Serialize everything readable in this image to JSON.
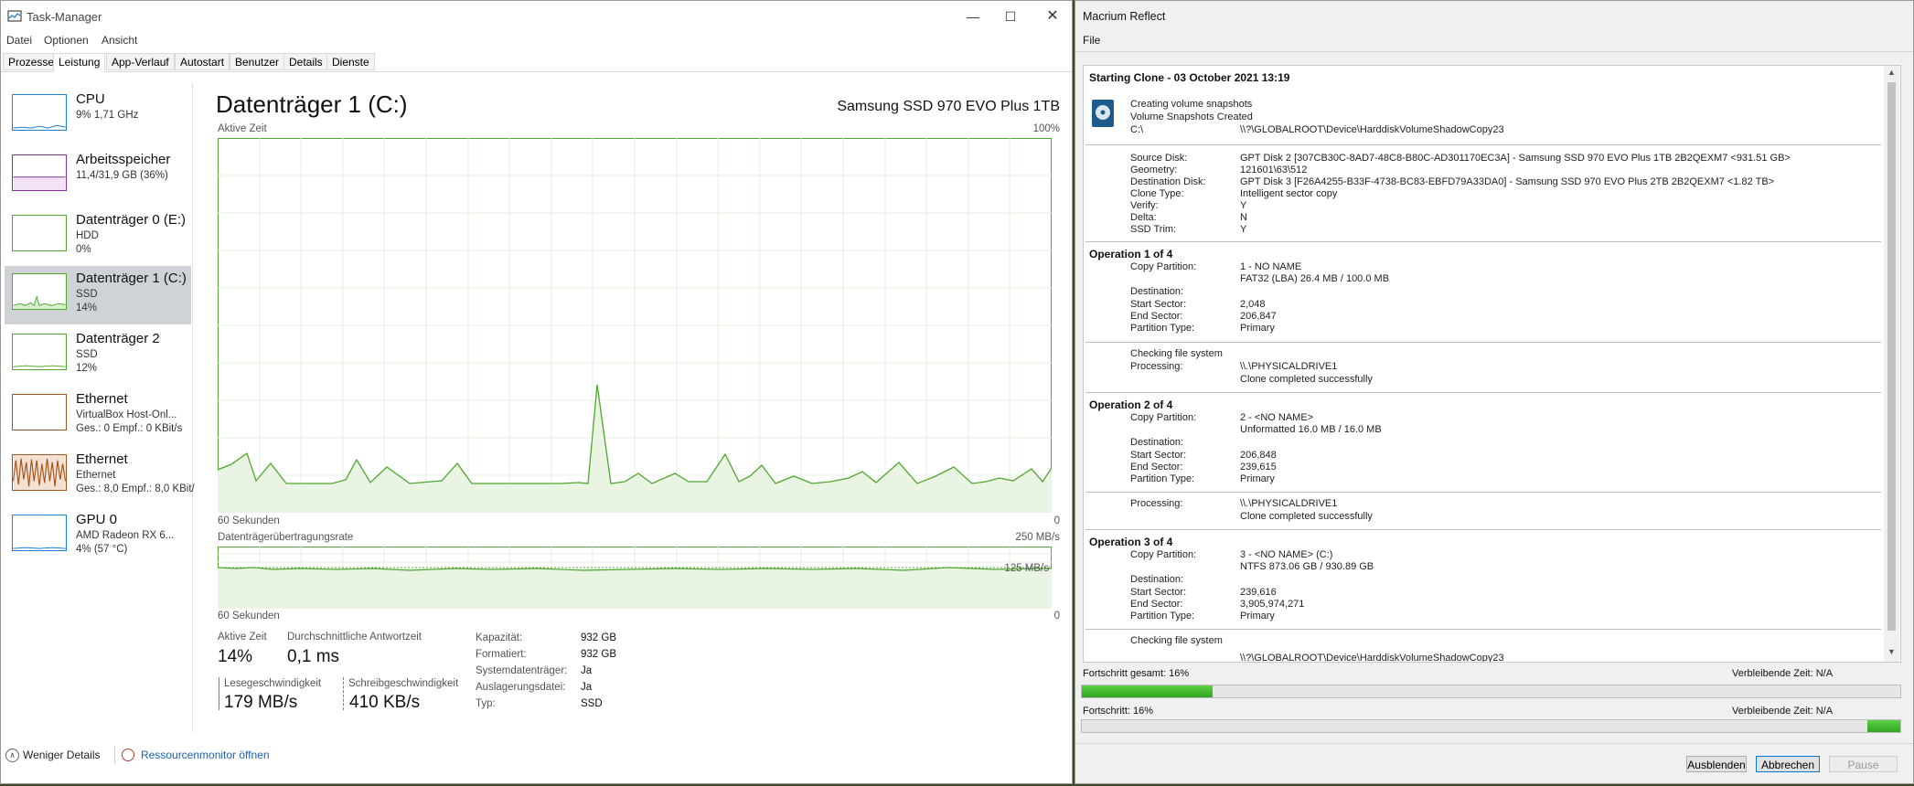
{
  "taskmanager": {
    "title": "Task-Manager",
    "menu": [
      "Datei",
      "Optionen",
      "Ansicht"
    ],
    "tabs": [
      "Prozesse",
      "Leistung",
      "App-Verlauf",
      "Autostart",
      "Benutzer",
      "Details",
      "Dienste"
    ],
    "sidebar": [
      {
        "name": "CPU",
        "sub1": "9% 1,71 GHz",
        "sub2": "",
        "sub3": "",
        "color": "#1d7fd4"
      },
      {
        "name": "Arbeitsspeicher",
        "sub1": "11,4/31,9 GB (36%)",
        "sub2": "",
        "sub3": "",
        "color": "#8b2fa8"
      },
      {
        "name": "Datenträger 0 (E:)",
        "sub1": "HDD",
        "sub2": "0%",
        "sub3": "",
        "color": "#4ea72e"
      },
      {
        "name": "Datenträger 1 (C:)",
        "sub1": "SSD",
        "sub2": "14%",
        "sub3": "",
        "color": "#4ea72e"
      },
      {
        "name": "Datenträger 2",
        "sub1": "SSD",
        "sub2": "12%",
        "sub3": "",
        "color": "#4ea72e"
      },
      {
        "name": "Ethernet",
        "sub1": "VirtualBox Host-Onl...",
        "sub2": "Ges.: 0 Empf.: 0 KBit/s",
        "sub3": "",
        "color": "#a6531b"
      },
      {
        "name": "Ethernet",
        "sub1": "Ethernet",
        "sub2": "Ges.: 8,0 Empf.: 8,0 KBit/",
        "sub3": "",
        "color": "#a6531b"
      },
      {
        "name": "GPU 0",
        "sub1": "AMD Radeon RX 6...",
        "sub2": "4% (57 °C)",
        "sub3": "",
        "color": "#1d7fd4"
      }
    ],
    "main": {
      "title": "Datenträger 1 (C:)",
      "device": "Samsung SSD 970 EVO Plus 1TB",
      "graph1_label": "Aktive Zeit",
      "graph1_max": "100%",
      "graph1_time": "60 Sekunden",
      "graph1_zero": "0",
      "graph2_label": "Datenträgerübertragungsrate",
      "graph2_max": "250 MB/s",
      "graph2_mid": "125 MB/s",
      "graph2_time": "60 Sekunden",
      "graph2_zero": "0",
      "stats": {
        "active_label": "Aktive Zeit",
        "active_value": "14%",
        "response_label": "Durchschnittliche Antwortzeit",
        "response_value": "0,1 ms",
        "read_label": "Lesegeschwindigkeit",
        "read_value": "179 MB/s",
        "write_label": "Schreibgeschwindigkeit",
        "write_value": "410 KB/s"
      },
      "props": [
        {
          "k": "Kapazität:",
          "v": "932 GB"
        },
        {
          "k": "Formatiert:",
          "v": "932 GB"
        },
        {
          "k": "Systemdatenträger:",
          "v": "Ja"
        },
        {
          "k": "Auslagerungsdatei:",
          "v": "Ja"
        },
        {
          "k": "Typ:",
          "v": "SSD"
        }
      ]
    },
    "footer": {
      "less": "Weniger Details",
      "resmon": "Ressourcenmonitor öffnen"
    }
  },
  "macrium": {
    "title": "Macrium Reflect",
    "menu": "File",
    "heading": "Starting Clone - 03 October 2021   13:19",
    "snapshot": [
      "Creating volume snapshots",
      "Volume Snapshots Created",
      "C:\\",
      "\\\\?\\GLOBALROOT\\Device\\HarddiskVolumeShadowCopy23"
    ],
    "info": [
      {
        "k": "Source Disk:",
        "v": "GPT Disk 2 [307CB30C-8AD7-48C8-B80C-AD301170EC3A] - Samsung SSD 970 EVO Plus 1TB 2B2QEXM7  <931.51 GB>"
      },
      {
        "k": "Geometry:",
        "v": "121601\\63\\512"
      },
      {
        "k": "Destination Disk:",
        "v": "GPT Disk 3 [F26A4255-B33F-4738-BC83-EBFD79A33DA0] - Samsung SSD 970 EVO Plus 2TB 2B2QEXM7  <1.82 TB>"
      },
      {
        "k": "Clone Type:",
        "v": "Intelligent sector copy"
      },
      {
        "k": "Verify:",
        "v": "Y"
      },
      {
        "k": "Delta:",
        "v": "N"
      },
      {
        "k": "SSD Trim:",
        "v": "Y"
      }
    ],
    "op1": {
      "head": "Operation 1 of 4",
      "rows": [
        {
          "k": "Copy Partition:",
          "v": "1 - NO NAME"
        },
        {
          "k": "",
          "v": "FAT32 (LBA) 26.4 MB / 100.0 MB"
        },
        {
          "k": "Destination:",
          "v": ""
        },
        {
          "k": "Start Sector:",
          "v": "2,048"
        },
        {
          "k": "End Sector:",
          "v": "206,847"
        },
        {
          "k": "Partition Type:",
          "v": "Primary"
        }
      ],
      "check": "Checking file system",
      "proc_k": "Processing:",
      "proc_v": "\\\\.\\PHYSICALDRIVE1",
      "done": "Clone completed successfully"
    },
    "op2": {
      "head": "Operation 2 of 4",
      "rows": [
        {
          "k": "Copy Partition:",
          "v": "2 - <NO NAME>"
        },
        {
          "k": "",
          "v": "Unformatted 16.0 MB / 16.0 MB"
        },
        {
          "k": "Destination:",
          "v": ""
        },
        {
          "k": "Start Sector:",
          "v": "206,848"
        },
        {
          "k": "End Sector:",
          "v": "239,615"
        },
        {
          "k": "Partition Type:",
          "v": "Primary"
        }
      ],
      "proc_k": "Processing:",
      "proc_v": "\\\\.\\PHYSICALDRIVE1",
      "done": "Clone completed successfully"
    },
    "op3": {
      "head": "Operation 3 of 4",
      "rows": [
        {
          "k": "Copy Partition:",
          "v": "3 - <NO NAME> (C:)"
        },
        {
          "k": "",
          "v": "NTFS 873.06 GB / 930.89 GB"
        },
        {
          "k": "Destination:",
          "v": ""
        },
        {
          "k": "Start Sector:",
          "v": "239,616"
        },
        {
          "k": "End Sector:",
          "v": "3,905,974,271"
        },
        {
          "k": "Partition Type:",
          "v": "Primary"
        }
      ],
      "check": "Checking file system",
      "proc_partial": "\\\\?\\GLOBALROOT\\Device\\HarddiskVolumeShadowCopy23"
    },
    "progress_total_label": "Fortschritt gesamt:  16%",
    "progress_total_pct": 16,
    "remaining1": "Verbleibende Zeit: N/A",
    "progress_label": "Fortschritt:  16%",
    "progress_pct": 16,
    "remaining2": "Verbleibende Zeit: N/A",
    "buttons": {
      "hide": "Ausblenden",
      "cancel": "Abbrechen",
      "pause": "Pause"
    }
  }
}
